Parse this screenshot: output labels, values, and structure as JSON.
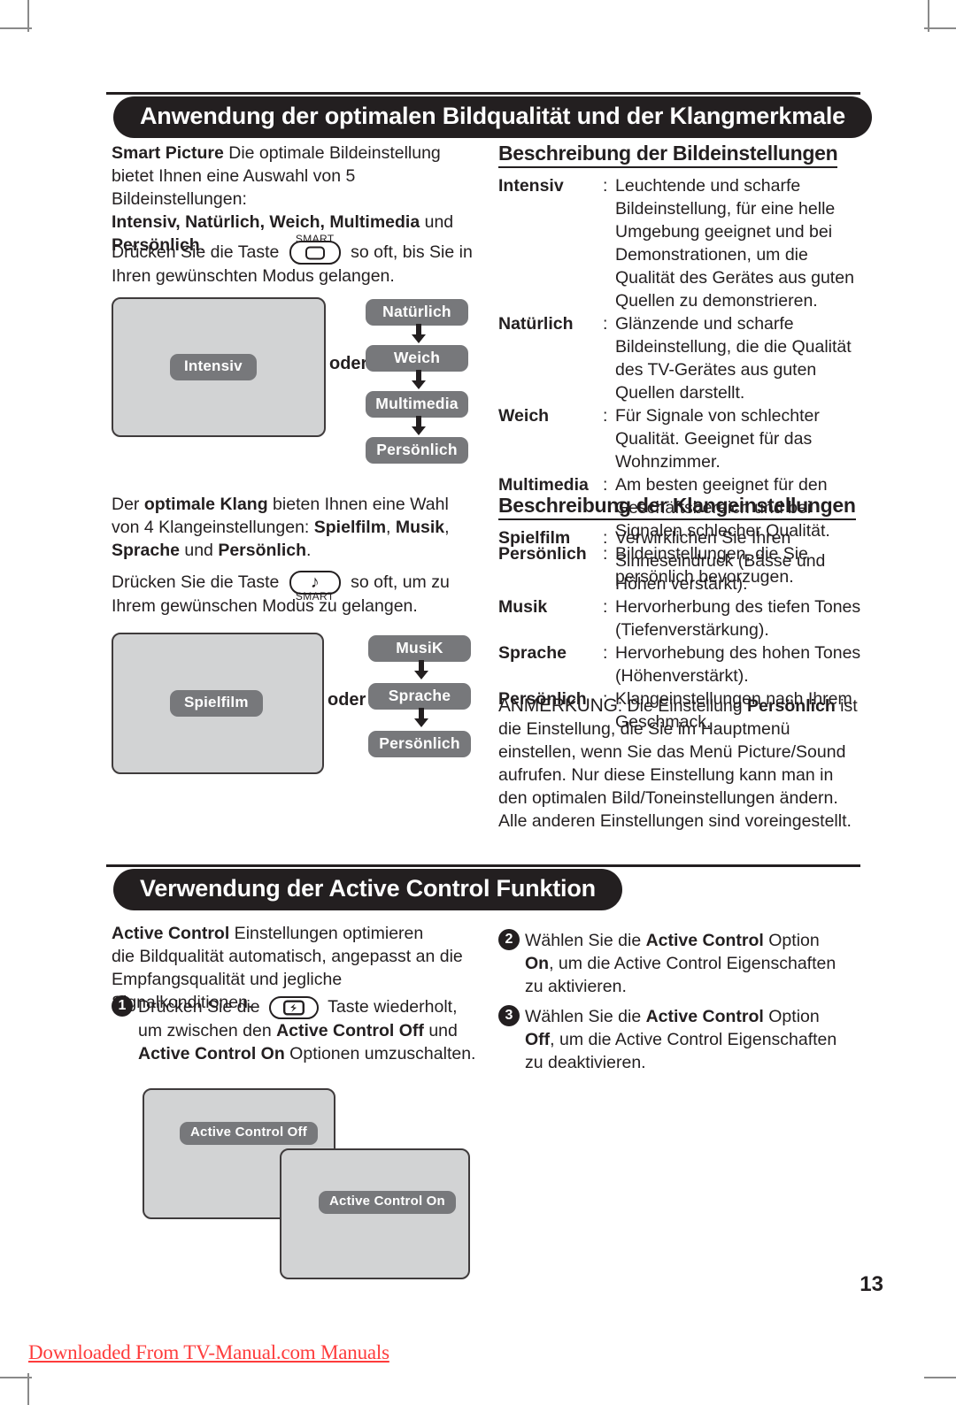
{
  "page": {
    "number": "13",
    "download_note": "Downloaded From TV-Manual.com Manuals"
  },
  "section1": {
    "banner_title": "Anwendung der optimalen Bildqualität und der Klangmerkmale",
    "picture_intro": {
      "lead_bold": "Smart Picture",
      "line1_rest": " Die optimale Bildeinstellung",
      "line2": "bietet Ihnen eine Auswahl von 5 Bildeinstellungen:",
      "line3_bold": "Intensiv, Natürlich, Weich, Multimedia",
      "line3_rest": " und",
      "line4_bold": "Persönlich",
      "line4_rest": "."
    },
    "picture_press": {
      "before": "Drücken Sie die Taste",
      "key_label": "SMART",
      "key_icon": "screen-icon",
      "after": "so oft, bis Sie in",
      "line2": "Ihren gewünschten Modus gelangen."
    },
    "picture_diagram": {
      "screen_badge": "Intensiv",
      "or_label": "oder",
      "flow": [
        "Natürlich",
        "Weich",
        "Multimedia",
        "Persönlich"
      ]
    },
    "sound_intro": {
      "p1_a": "Der ",
      "p1_bold": "optimale Klang",
      "p1_b": " bieten Ihnen eine Wahl",
      "p2_a": "von 4 Klangeinstellungen: ",
      "p2_bold1": "Spielfilm",
      "p2_mid": ", ",
      "p2_bold2": "Musik",
      "p2_end": ",",
      "p3_bold1": "Sprache",
      "p3_mid": " und ",
      "p3_bold2": "Persönlich",
      "p3_end": "."
    },
    "sound_press": {
      "before": "Drücken Sie die Taste",
      "key_label": "SMART",
      "key_icon": "music-note-icon",
      "after": "so oft, um zu",
      "line2": "Ihrem gewünschen Modus zu gelangen."
    },
    "sound_diagram": {
      "screen_badge": "Spielfilm",
      "or_label": "oder",
      "flow": [
        "MusiK",
        "Sprache",
        "Persönlich"
      ]
    },
    "picture_desc": {
      "heading": "Beschreibung der Bildeinstellungen",
      "items": [
        {
          "term": "Intensiv",
          "desc": "Leuchtende und scharfe Bildeinstellung, für eine helle Umgebung geeignet und bei Demonstrationen, um die Qualität des Gerätes aus guten Quellen zu demonstrieren."
        },
        {
          "term": "Natürlich",
          "desc": "Glänzende und scharfe Bildeinstellung, die die Qualität des TV-Gerätes aus guten Quellen darstellt."
        },
        {
          "term": "Weich",
          "desc": "Für Signale von schlechter Qualität. Geeignet für das Wohnzimmer."
        },
        {
          "term": "Multimedia",
          "desc": "Am besten geeignet für den Geschäftsbereich und bei Signalen schlecher Qualität."
        },
        {
          "term": "Persönlich",
          "desc": "Bildeinstellungen, die Sie persönlich bevorzugen."
        }
      ]
    },
    "sound_desc": {
      "heading": "Beschreibung der Klangeinstellungen",
      "items": [
        {
          "term": "Spielfilm",
          "desc": "Verwirklichen Sie Ihren Sinneseindruck (Bässe und Höhen verstärkt)."
        },
        {
          "term": "Musik",
          "desc": "Hervorherbung des tiefen Tones (Tiefenverstärkung)."
        },
        {
          "term": "Sprache",
          "desc": "Hervorhebung des hohen Tones (Höhenverstärkt)."
        },
        {
          "term": "Persönlich",
          "desc": "Klangeinstellungen nach Ihrem Geschmack."
        }
      ]
    },
    "note": {
      "label": "ANMERKUNG",
      "a": ": Die Einstellung ",
      "bold": "Persönlich",
      "b": " ist die Einstellung, die Sie im Hauptmenü einstellen, wenn Sie das Menü Picture/Sound aufrufen. Nur diese Einstellung kann man in den optimalen Bild/Toneinstellungen ändern. Alle anderen Einstellungen sind voreingestellt."
    }
  },
  "section2": {
    "banner_title": "Verwendung der Active Control Funktion",
    "intro": {
      "bold": "Active Control",
      "rest_l1": " Einstellungen optimieren",
      "l2": "die Bildqualität automatisch, angepasst an die",
      "l3": "Empfangsqualität und jegliche Signalkonditionen."
    },
    "step1": {
      "num": "1",
      "a": "Drücken Sie die",
      "key_icon": "active-control-icon",
      "b": "Taste wiederholt,",
      "l2_a": "um zwischen den ",
      "l2_bold": "Active Control Off",
      "l2_b": " und",
      "l3_bold": "Active Control On",
      "l3_b": " Optionen umzuschalten."
    },
    "step2": {
      "num": "2",
      "a": "Wählen Sie die ",
      "bold1": "Active Control",
      "b": " Option",
      "l2_bold": "On",
      "l2_rest": ", um die Active Control Eigenschaften",
      "l3": "zu aktivieren."
    },
    "step3": {
      "num": "3",
      "a": "Wählen Sie die ",
      "bold1": "Active Control",
      "b": " Option",
      "l2_bold": "Off",
      "l2_rest": ", um die Active Control Eigenschaften",
      "l3": "zu deaktivieren."
    },
    "screens": {
      "off_badge": "Active Control Off",
      "on_badge": "Active Control On"
    }
  },
  "colors": {
    "banner_bg": "#231f20",
    "screen_fill": "#d2d3d4",
    "screen_border": "#3f3b3c",
    "badge_bg": "#77787b",
    "note_red": "#fe3c3c"
  }
}
